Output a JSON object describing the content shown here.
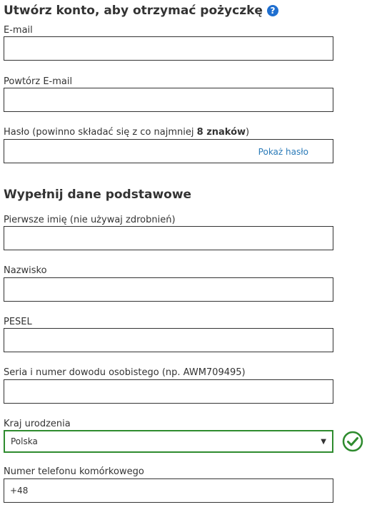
{
  "account": {
    "title": "Utwórz konto, aby otrzymać pożyczkę",
    "help_icon": "?",
    "email_label": "E-mail",
    "email_value": "",
    "email_repeat_label": "Powtórz E-mail",
    "email_repeat_value": "",
    "password_label_prefix": "Hasło (powinno składać się z co najmniej ",
    "password_label_bold": "8 znaków",
    "password_label_suffix": ")",
    "password_value": "",
    "show_password": "Pokaż hasło"
  },
  "basic": {
    "title": "Wypełnij dane podstawowe",
    "first_name_label": "Pierwsze imię (nie używaj zdrobnień)",
    "first_name_value": "",
    "last_name_label": "Nazwisko",
    "last_name_value": "",
    "pesel_label": "PESEL",
    "pesel_value": "",
    "id_label": "Seria i numer dowodu osobistego (np. AWM709495)",
    "id_value": "",
    "country_label": "Kraj urodzenia",
    "country_selected": "Polska",
    "phone_label": "Numer telefonu komórkowego",
    "phone_value": "+48"
  },
  "colors": {
    "valid": "#2e8b2e",
    "link": "#2a7ab8",
    "help": "#1f6fd0"
  },
  "icons": {
    "help": "question-circle-icon",
    "valid": "check-circle-icon",
    "dropdown": "caret-down-icon"
  }
}
